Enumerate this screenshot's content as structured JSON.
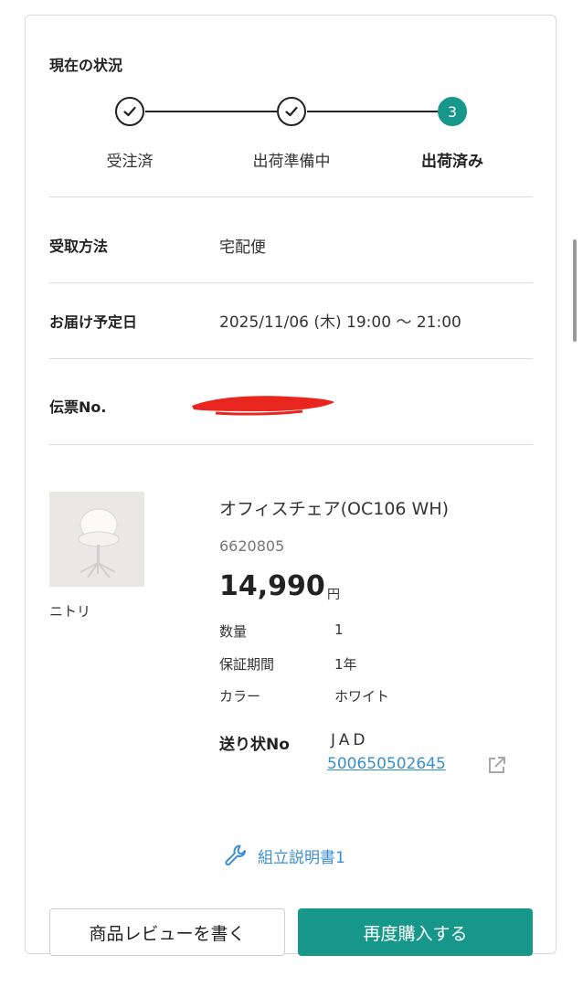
{
  "status": {
    "title": "現在の状況",
    "steps": [
      {
        "label": "受注済",
        "state": "done"
      },
      {
        "label": "出荷準備中",
        "state": "done"
      },
      {
        "label": "出荷済み",
        "state": "current",
        "number": "3"
      }
    ]
  },
  "details": {
    "receive_method": {
      "label": "受取方法",
      "value": "宅配便"
    },
    "delivery_date": {
      "label": "お届け予定日",
      "value": "2025/11/06 (木) 19:00 〜 21:00"
    },
    "slip": {
      "label": "伝票No."
    }
  },
  "product": {
    "brand": "ニトリ",
    "name": "オフィスチェア(OC106 WH)",
    "code": "6620805",
    "price": "14,990",
    "currency": "円",
    "specs": [
      {
        "label": "数量",
        "value": "1"
      },
      {
        "label": "保証期間",
        "value": "1年"
      },
      {
        "label": "カラー",
        "value": "ホワイト"
      }
    ],
    "invoice": {
      "label": "送り状No",
      "carrier": "JAD",
      "number": "500650502645"
    },
    "manual_link": "組立説明書1"
  },
  "actions": {
    "review": "商品レビューを書く",
    "rebuy": "再度購入する"
  },
  "colors": {
    "accent": "#17978a",
    "link": "#3a8fd0",
    "redaction": "#e8261f"
  }
}
